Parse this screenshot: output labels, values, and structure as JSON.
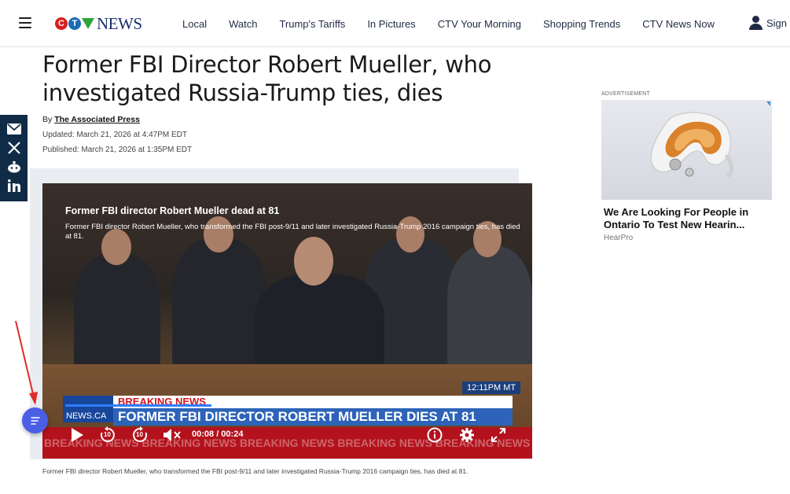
{
  "header": {
    "logo_text": "CTV",
    "logo_news": "NEWS",
    "nav": [
      "Local",
      "Watch",
      "Trump's Tariffs",
      "In Pictures",
      "CTV Your Morning",
      "Shopping Trends",
      "CTV News Now"
    ],
    "signin_label": "Sign"
  },
  "article": {
    "headline": "Former FBI Director Robert Mueller, who investigated Russia-Trump ties, dies",
    "by_prefix": "By",
    "author": "The Associated Press",
    "updated": "Updated: March 21, 2026 at 4:47PM EDT",
    "published": "Published: March 21, 2026 at 1:35PM EDT",
    "caption": "Former FBI director Robert Mueller, who transformed the FBI post-9/11 and later investigated Russia-Trump 2016 campaign ties, has died at 81."
  },
  "share": [
    "email-icon",
    "x-icon",
    "reddit-icon",
    "linkedin-icon"
  ],
  "video": {
    "title": "Former FBI director Robert Mueller dead at 81",
    "description": "Former FBI director Robert Mueller, who transformed the FBI post-9/11 and later investigated Russia-Trump 2016 campaign ties, has died at 81.",
    "ticker_time": "12:11PM MT",
    "ticker_logo": "NEWS.CA",
    "ticker_breaking": "BREAKING NEWS",
    "ticker_headline": "FORMER FBI DIRECTOR ROBERT MUELLER DIES AT 81",
    "ticker_strip": "BREAKING NEWS    BREAKING NEWS    BREAKING NEWS    BREAKING NEWS    BREAKING NEWS    BREAK",
    "time_display": "00:08 / 00:24",
    "progress": 0.33,
    "rewind_label": "10",
    "forward_label": "10"
  },
  "ad": {
    "label": "ADVERTISEMENT",
    "title": "We Are Looking For People in Ontario To Test New Hearin...",
    "source": "HearPro"
  },
  "colors": {
    "brand_navy": "#0f2b46",
    "float_button": "#4b5ee6",
    "annotation_arrow": "#e02b2b"
  }
}
